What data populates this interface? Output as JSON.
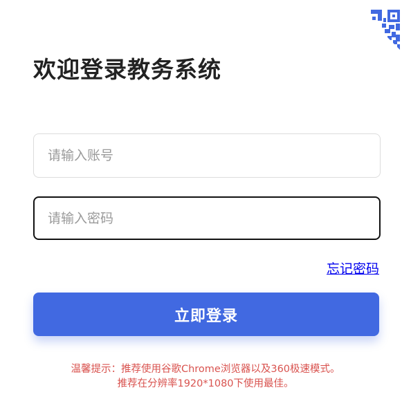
{
  "login": {
    "title": "欢迎登录教务系统",
    "account_placeholder": "请输入账号",
    "password_placeholder": "请输入密码",
    "forgot_label": "忘记密码",
    "submit_label": "立即登录",
    "tip_line1": "温馨提示：推荐使用谷歌Chrome浏览器以及360极速模式。",
    "tip_line2": "推荐在分辨率1920*1080下使用最佳。"
  },
  "corner": {
    "icon": "qr-code-icon"
  },
  "colors": {
    "accent": "#4169e1",
    "tip": "#d9534f",
    "title": "#222222",
    "link": "#0000ee"
  }
}
